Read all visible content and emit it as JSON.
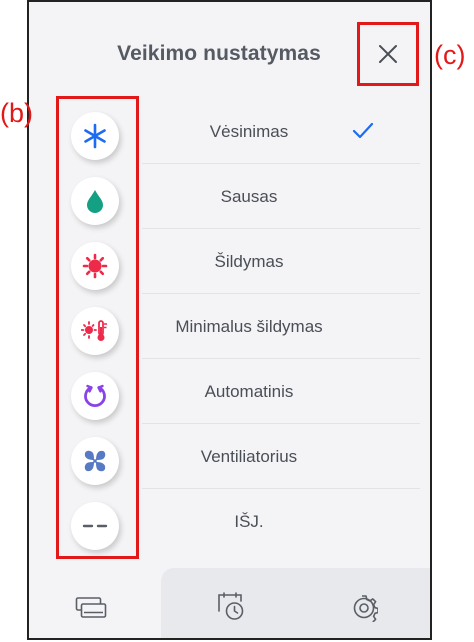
{
  "header": {
    "title": "Veikimo nustatymas"
  },
  "modes": [
    {
      "label": "Vėsinimas",
      "icon": "snowflake-icon",
      "selected": true
    },
    {
      "label": "Sausas",
      "icon": "droplet-icon",
      "selected": false
    },
    {
      "label": "Šildymas",
      "icon": "sun-icon",
      "selected": false
    },
    {
      "label": "Minimalus šildymas",
      "icon": "thermometer-sun-icon",
      "selected": false
    },
    {
      "label": "Automatinis",
      "icon": "auto-cycle-icon",
      "selected": false
    },
    {
      "label": "Ventiliatorius",
      "icon": "fan-icon",
      "selected": false
    },
    {
      "label": "IŠJ.",
      "icon": "off-dashes-icon",
      "selected": false
    }
  ],
  "tabs": [
    {
      "icon": "units-icon",
      "active": true
    },
    {
      "icon": "timer-icon",
      "active": false
    },
    {
      "icon": "gear-icon",
      "active": false
    }
  ],
  "annotations": {
    "b": "(b)",
    "c": "(c)"
  },
  "colors": {
    "cool": "#1b6cf2",
    "dry": "#14a183",
    "heat": "#ee2a4a",
    "auto": "#8a44e6",
    "fan": "#5879c4",
    "off": "#5a5e66",
    "annotation": "#e31919"
  }
}
